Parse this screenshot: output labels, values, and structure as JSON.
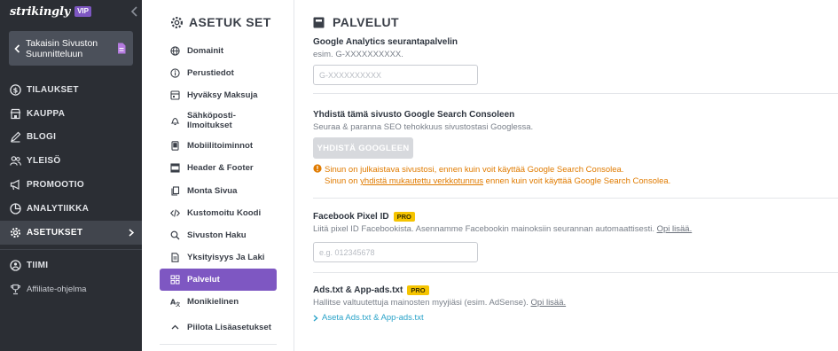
{
  "sidebar": {
    "brand": "strikingly",
    "vip_badge": "VIP",
    "back_label": "Takaisin Sivuston Suunnitteluun",
    "items": [
      {
        "label": "TILAUKSET",
        "icon": "dollar-circle-icon"
      },
      {
        "label": "KAUPPA",
        "icon": "store-icon"
      },
      {
        "label": "BLOGI",
        "icon": "pen-icon"
      },
      {
        "label": "YLEISÖ",
        "icon": "users-icon"
      },
      {
        "label": "PROMOOTIO",
        "icon": "megaphone-icon"
      },
      {
        "label": "ANALYTIIKKA",
        "icon": "pie-chart-icon"
      },
      {
        "label": "ASETUKSET",
        "icon": "gear-icon",
        "active": true
      },
      {
        "label": "TIIMI",
        "icon": "team-icon"
      },
      {
        "label": "Affiliate-ohjelma",
        "icon": "trophy-icon"
      }
    ]
  },
  "settings": {
    "title": "ASETUK SET",
    "items": [
      {
        "label": "Domainit",
        "icon": "globe-icon"
      },
      {
        "label": "Perustiedot",
        "icon": "info-icon"
      },
      {
        "label": "Hyväksy Maksuja",
        "icon": "payment-icon"
      },
      {
        "label": "Sähköposti-Ilmoitukset",
        "icon": "bell-icon"
      },
      {
        "label": "Mobiilitoiminnot",
        "icon": "mobile-icon"
      },
      {
        "label": "Header & Footer",
        "icon": "layout-icon"
      },
      {
        "label": "Monta Sivua",
        "icon": "pages-icon"
      },
      {
        "label": "Kustomoitu Koodi",
        "icon": "code-icon"
      },
      {
        "label": "Sivuston Haku",
        "icon": "search-icon"
      },
      {
        "label": "Yksityisyys Ja Laki",
        "icon": "document-icon"
      },
      {
        "label": "Palvelut",
        "icon": "grid-icon",
        "active": true
      },
      {
        "label": "Monikielinen",
        "icon": "language-icon"
      },
      {
        "label": "Piilota Lisäasetukset",
        "icon": "chevron-up-icon"
      }
    ]
  },
  "main": {
    "title": "PALVELUT",
    "ga": {
      "title": "Google Analytics seurantapalvelin",
      "hint": "esim. G-XXXXXXXXXX.",
      "placeholder": "G-XXXXXXXXXX",
      "value": ""
    },
    "gsc": {
      "title": "Yhdistä tämä sivusto Google Search Consoleen",
      "desc": "Seuraa & paranna SEO tehokkuus sivustostasi Googlessa.",
      "button": "YHDISTÄ GOOGLEEN",
      "warn1": "Sinun on julkaistava sivustosi, ennen kuin voit käyttää Google Search Consolea.",
      "warn2_pre": "Sinun on ",
      "warn2_link": "yhdistä mukautettu verkkotunnus",
      "warn2_post": " ennen kuin voit käyttää Google Search Consolea."
    },
    "fb": {
      "title": "Facebook Pixel ID",
      "badge": "PRO",
      "desc": "Liitä pixel ID Facebookista. Asennamme Facebookin mainoksiin seurannan automaattisesti.",
      "link": "Opi lisää.",
      "placeholder": "e.g. 012345678",
      "value": ""
    },
    "ads": {
      "title": "Ads.txt & App-ads.txt",
      "badge": "PRO",
      "desc": "Hallitse valtuutettuja mainosten myyjiäsi (esim. AdSense).",
      "link": "Opi lisää.",
      "action": "Aseta Ads.txt & App-ads.txt"
    }
  },
  "colors": {
    "sidebar_bg": "#2b2e34",
    "accent_purple": "#7e57c2",
    "pro_yellow": "#f5c400",
    "warning_orange": "#e07b00",
    "link_blue": "#2aa3c9"
  }
}
